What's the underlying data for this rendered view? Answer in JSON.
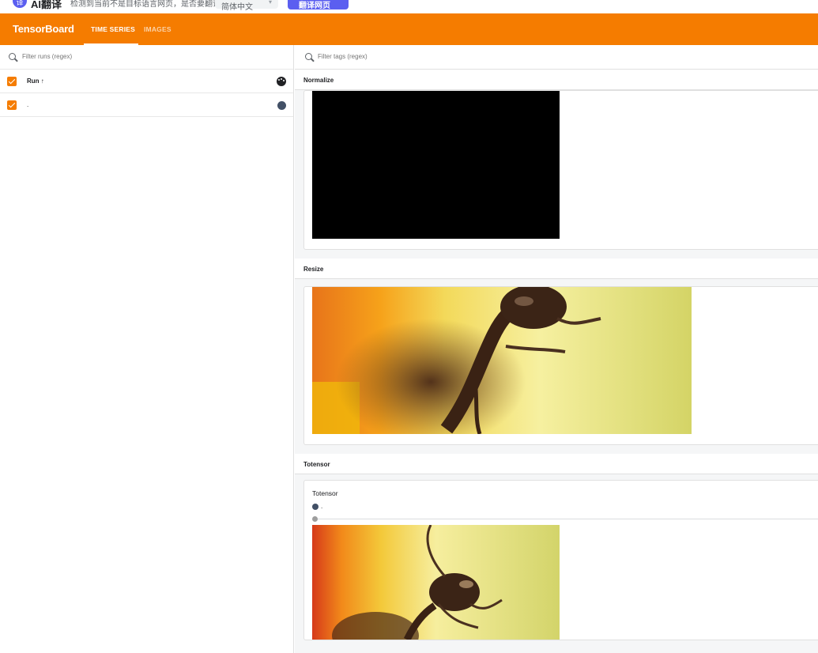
{
  "translate_bar": {
    "logo_glyph": "译",
    "title": "AI翻译",
    "message": "检测到当前不是目标语言网页，是否要翻译为：",
    "language_selected": "简体中文",
    "translate_button": "翻译网页"
  },
  "header": {
    "brand": "TensorBoard",
    "tabs": [
      {
        "label": "TIME SERIES",
        "active": true
      },
      {
        "label": "IMAGES",
        "active": false
      }
    ],
    "background_color": "#f57c00"
  },
  "sidebar": {
    "filter_placeholder": "Filter runs (regex)",
    "header_row": {
      "label": "Run ↑",
      "checked": true
    },
    "runs": [
      {
        "label": ".",
        "checked": true,
        "color": "#425066"
      }
    ]
  },
  "main": {
    "tag_filter_placeholder": "Filter tags (regex)",
    "groups": [
      {
        "title": "Normalize"
      },
      {
        "title": "Resize"
      },
      {
        "title": "Totensor",
        "card_title": "Totensor",
        "legend_run": "."
      }
    ]
  }
}
